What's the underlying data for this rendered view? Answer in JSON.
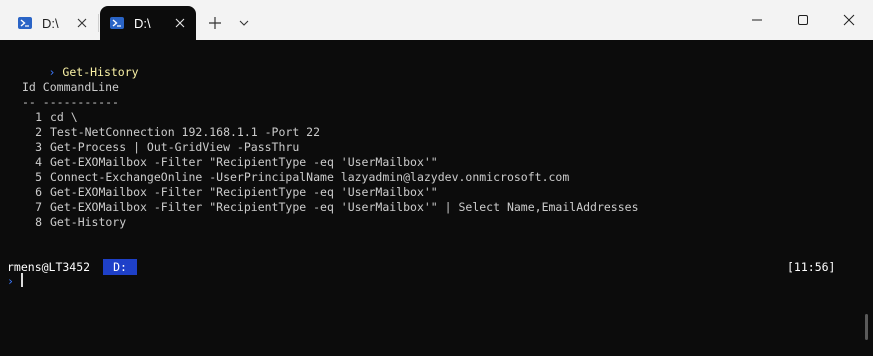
{
  "window": {
    "tabs": [
      {
        "label": "D:\\",
        "active": false
      },
      {
        "label": "D:\\",
        "active": true
      }
    ],
    "icons": {
      "tab_icon": "powershell-icon",
      "close": "close-icon",
      "new_tab": "plus-icon",
      "dropdown": "chevron-down-icon",
      "minimize": "minimize-icon",
      "maximize": "maximize-icon",
      "window_close": "close-icon"
    },
    "colors": {
      "titlebar": "#f3f3f3",
      "terminal_bg": "#0c0c0c",
      "accent": "#3b78ff",
      "command": "#f9f1a5",
      "drive_badge": "#1e40c8"
    }
  },
  "terminal": {
    "prompt_glyph": "›",
    "command": "Get-History",
    "header": {
      "id": "Id",
      "command": "CommandLine"
    },
    "underline": {
      "id": "--",
      "command": "-----------"
    },
    "rows": [
      {
        "id": "1",
        "command": "cd \\"
      },
      {
        "id": "2",
        "command": "Test-NetConnection 192.168.1.1 -Port 22"
      },
      {
        "id": "3",
        "command": "Get-Process | Out-GridView -PassThru"
      },
      {
        "id": "4",
        "command": "Get-EXOMailbox -Filter \"RecipientType -eq 'UserMailbox'\""
      },
      {
        "id": "5",
        "command": "Connect-ExchangeOnline -UserPrincipalName lazyadmin@lazydev.onmicrosoft.com"
      },
      {
        "id": "6",
        "command": "Get-EXOMailbox -Filter \"RecipientType -eq 'UserMailbox'\""
      },
      {
        "id": "7",
        "command": "Get-EXOMailbox -Filter \"RecipientType -eq 'UserMailbox'\" | Select Name,EmailAddresses"
      },
      {
        "id": "8",
        "command": "Get-History"
      }
    ],
    "status": {
      "user_host": "rmens@LT3452",
      "drive": "D:",
      "time": "[11:56]"
    }
  }
}
